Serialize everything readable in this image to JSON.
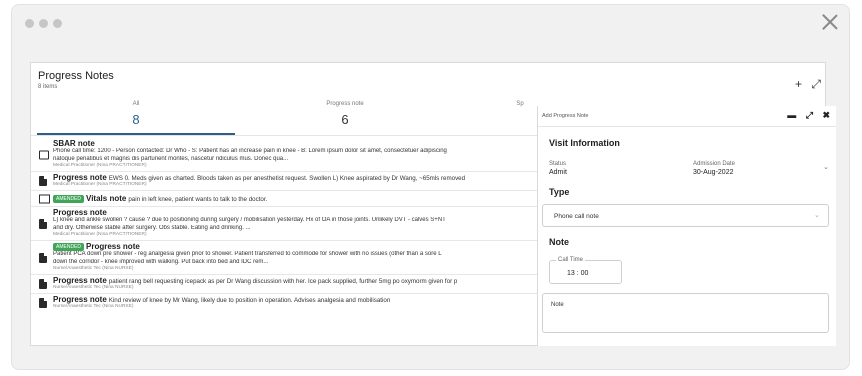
{
  "panel": {
    "title": "Progress Notes",
    "count": "8 items",
    "tools": {
      "add": "+",
      "expand": "⤢"
    }
  },
  "tabs": [
    {
      "label": "All",
      "count": "8",
      "active": true
    },
    {
      "label": "Progress note",
      "count": "6",
      "active": false
    },
    {
      "label": "Sp",
      "count": "",
      "active": false
    }
  ],
  "notes": [
    {
      "icon": "phone-icon",
      "badge": "",
      "type": "SBAR note",
      "summary": "",
      "body": "Phone call time: 1200 - Person contacted: Dr Who - S: Patient has an increase pain in knee - B: Lorem ipsum dolor sit amet, consectetuer adipiscing",
      "body2": "natoque penatibus et magnis dis parturient montes, nascetur ridiculus mus. Donec qua...",
      "author": "Medical Practitioner (Nina PRACTITIONER)"
    },
    {
      "icon": "document-icon",
      "badge": "",
      "type": "Progress note",
      "summary": "EWS 0. Meds given as charted. Bloods taken as per anesthetist request. Swollen L) Knee aspirated by Dr Wang, ~65mls removed",
      "body": "",
      "body2": "",
      "author": "Medical Practitioner (Nina PRACTITIONER)"
    },
    {
      "icon": "chart-icon",
      "badge": "AMENDED",
      "type": "Vitals note",
      "summary": "pain in left knee, patient wants to talk to the doctor.",
      "body": "",
      "body2": "",
      "author": ""
    },
    {
      "icon": "document-icon",
      "badge": "",
      "type": "Progress note",
      "summary": "",
      "body": "L) knee and ankle swollen ? cause ? due to positioning during surgery / mobilisation yesterday. Hx of OA in those joints. Unlikely DVT - calves S+NT",
      "body2": "and dry. Otherwise stable after surgery. Obs stable. Eating and drinking. ...",
      "author": "Medical Practitioner (Nina PRACTITIONER)"
    },
    {
      "icon": "document-icon",
      "badge": "AMENDED",
      "type": "Progress note",
      "summary": "",
      "body": "Patient PCA down pre shower - reg analgesia given prior to shower. Patient transferred to commode for shower with no issues (other than a sore L",
      "body2": "down the corridor - knee improved with walking. Put back into bed and IDC rem...",
      "author": "Nurse/Anaesthetic Tec (Nina NURSE)"
    },
    {
      "icon": "document-icon",
      "badge": "",
      "type": "Progress note",
      "summary": "patient rang bell requesting icepack as per Dr Wang discussion with her. Ice pack supplied, further 5mg po oxymorm given for p",
      "body": "",
      "body2": "",
      "author": "Nurse/Anaesthetic Tec (Nina NURSE)"
    },
    {
      "icon": "document-icon",
      "badge": "",
      "type": "Progress note",
      "summary": "Kind review of knee by Mr Wang, likely due to position in operation. Advises analgesia and mobilisation",
      "body": "",
      "body2": "",
      "author": "Nurse/Anaesthetic Tec (Nina NURSE)"
    }
  ],
  "side": {
    "title": "Add Progress Note",
    "visit_title": "Visit Information",
    "status_label": "Status",
    "status_value": "Admit",
    "admission_label": "Admission Date",
    "admission_value": "30-Aug-2022",
    "type_title": "Type",
    "type_value": "Phone call note",
    "note_title": "Note",
    "call_time_label": "Call Time",
    "call_time_value": "13  :  00",
    "note_label": "Note"
  },
  "colors": {
    "accent": "#2d5f8a",
    "amended": "#3fa557"
  }
}
